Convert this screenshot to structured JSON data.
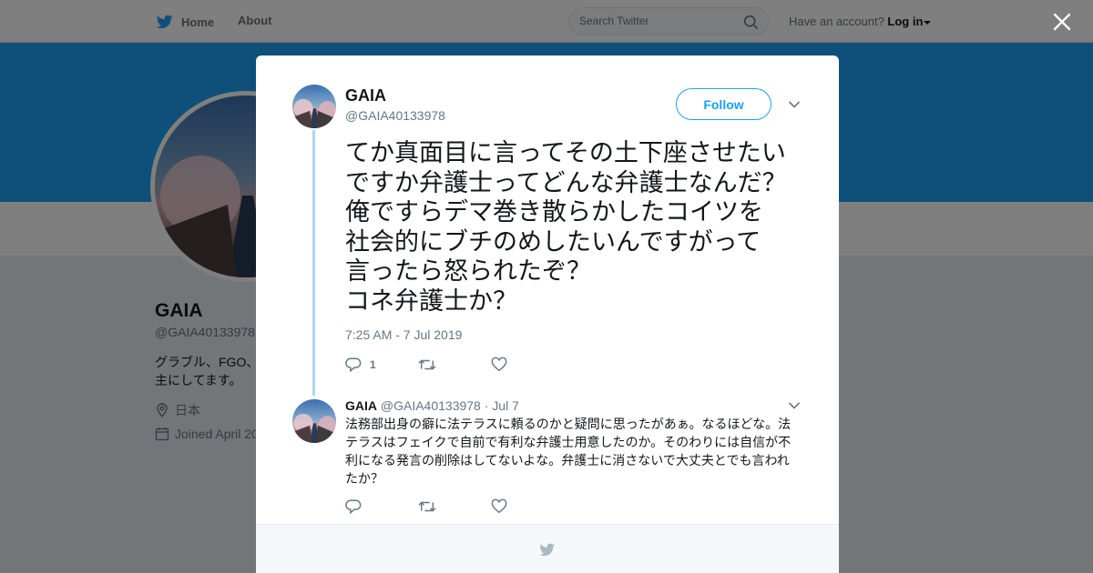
{
  "header": {
    "home_label": "Home",
    "about_label": "About",
    "search_placeholder": "Search Twitter",
    "account_prompt": "Have an account?",
    "login_label": "Log in"
  },
  "profile": {
    "name": "GAIA",
    "handle": "@GAIA40133978",
    "bio": "グラブル、FGO、\n主にしてます。",
    "location": "日本",
    "joined": "Joined April 20"
  },
  "tweet": {
    "name": "GAIA",
    "handle": "@GAIA40133978",
    "follow_label": "Follow",
    "text": "てか真面目に言ってその土下座させたい\nですか弁護士ってどんな弁護士なんだ？\n俺ですらデマ巻き散らかしたコイツを\n社会的にブチのめしたいんですがって\n言ったら怒られたぞ？\nコネ弁護士か？",
    "timestamp": "7:25 AM - 7 Jul 2019",
    "reply_count": "1"
  },
  "reply": {
    "name": "GAIA",
    "handle": "@GAIA40133978",
    "date": "· Jul 7",
    "text": "法務部出身の癖に法テラスに頼るのかと疑問に思ったがあぁ。なるほどな。法テラスはフェイクで自前で有利な弁護士用意したのか。そのわりには自信が不利になる発言の削除はしてないよな。弁護士に消さないで大丈夫とでも言われたか？"
  },
  "colors": {
    "brand": "#1da1f2",
    "thread_line": "#a9d7f3",
    "text": "#14171a",
    "muted": "#657786"
  },
  "icons": [
    "twitter-bird-icon",
    "search-icon",
    "close-icon",
    "chevron-down-icon",
    "reply-icon",
    "retweet-icon",
    "heart-icon",
    "location-icon",
    "calendar-icon"
  ]
}
